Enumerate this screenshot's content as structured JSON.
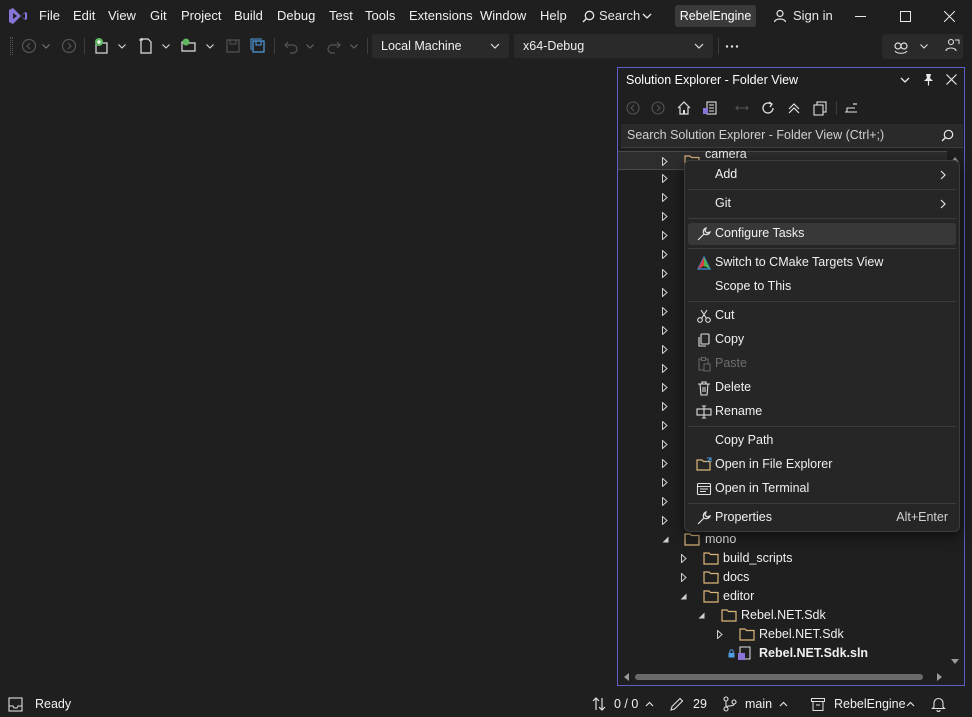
{
  "menu": {
    "file": "File",
    "edit": "Edit",
    "view": "View",
    "git": "Git",
    "project": "Project",
    "build": "Build",
    "debug": "Debug",
    "test": "Test",
    "tools": "Tools",
    "extensions": "Extensions",
    "window": "Window",
    "help": "Help"
  },
  "search": {
    "label": "Search"
  },
  "project_badge": "RebelEngine",
  "signin": "Sign in",
  "toolbar": {
    "target": "Local Machine",
    "configuration": "x64-Debug"
  },
  "solution_explorer": {
    "title": "Solution Explorer - Folder View",
    "search_placeholder": "Search Solution Explorer - Folder View (Ctrl+;)",
    "partial_top": "camera",
    "tree": [
      {
        "label": "mono",
        "expanded": true
      },
      {
        "label": "build_scripts"
      },
      {
        "label": "docs"
      },
      {
        "label": "editor",
        "expanded": true
      },
      {
        "label": "Rebel.NET.Sdk",
        "expanded": true
      },
      {
        "label": "Rebel.NET.Sdk"
      },
      {
        "label": "Rebel.NET.Sdk.sln"
      }
    ]
  },
  "context_menu": {
    "add": "Add",
    "git": "Git",
    "configure_tasks": "Configure Tasks",
    "switch_cmake": "Switch to CMake Targets View",
    "scope": "Scope to This",
    "cut": "Cut",
    "copy": "Copy",
    "paste": "Paste",
    "delete": "Delete",
    "rename": "Rename",
    "copy_path": "Copy Path",
    "open_explorer": "Open in File Explorer",
    "open_terminal": "Open in Terminal",
    "properties": "Properties",
    "properties_shortcut": "Alt+Enter"
  },
  "status": {
    "ready": "Ready",
    "sync": "0 / 0",
    "changes": "29",
    "branch": "main",
    "repo": "RebelEngine"
  },
  "colors": {
    "accent": "#5b5fc7",
    "folder": "#dcb67a",
    "background": "#1f1f1f"
  }
}
